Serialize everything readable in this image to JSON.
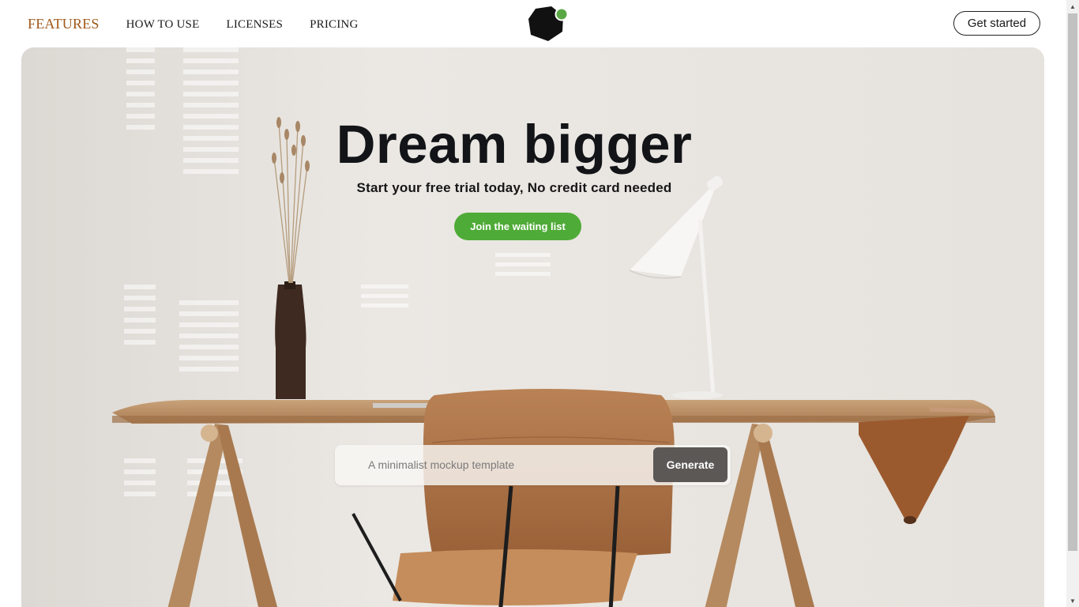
{
  "nav": {
    "links": [
      {
        "label": "FEATURES",
        "active": true
      },
      {
        "label": "HOW TO USE",
        "active": false
      },
      {
        "label": "LICENSES",
        "active": false
      },
      {
        "label": "PRICING",
        "active": false
      }
    ],
    "cta_label": "Get started",
    "logo_icon": "hexagon-logo-icon",
    "active_color": "#a0581a"
  },
  "hero": {
    "title": "Dream bigger",
    "subtitle": "Start your free trial today, No credit card needed",
    "cta_label": "Join the waiting list",
    "cta_color": "#4fab37"
  },
  "generator": {
    "placeholder": "A minimalist mockup template",
    "value": "",
    "button_label": "Generate"
  },
  "colors": {
    "accent_green": "#4fab37",
    "generate_button": "#5b5856",
    "title_text": "#121417"
  }
}
